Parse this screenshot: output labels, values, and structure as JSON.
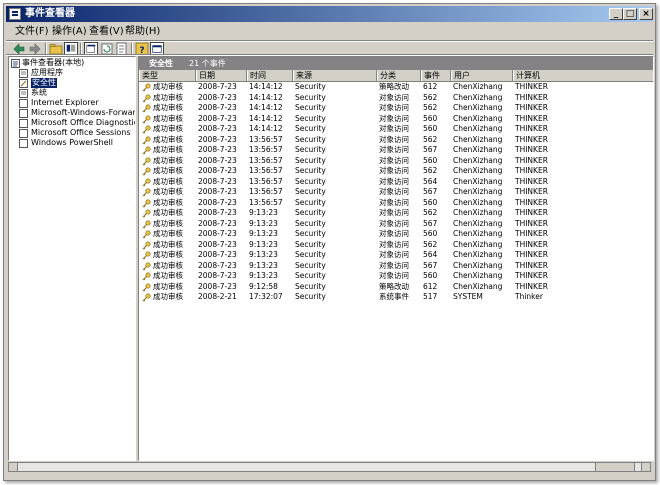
{
  "window": {
    "title": "事件查看器",
    "min_label": "_",
    "max_label": "□",
    "close_label": "×"
  },
  "menu": [
    "文件(F)",
    "操作(A)",
    "查看(V)",
    "帮助(H)"
  ],
  "tree": {
    "root": "事件查看器(本地)",
    "items": [
      {
        "label": "应用程序"
      },
      {
        "label": "安全性",
        "selected": true
      },
      {
        "label": "系统"
      },
      {
        "label": "Internet Explorer"
      },
      {
        "label": "Microsoft-Windows-Forwarding"
      },
      {
        "label": "Microsoft Office Diagnostics"
      },
      {
        "label": "Microsoft Office Sessions"
      },
      {
        "label": "Windows PowerShell"
      }
    ]
  },
  "right": {
    "pane_title": "安全性",
    "event_count": "21 个事件",
    "columns": [
      "类型",
      "日期",
      "时间",
      "来源",
      "分类",
      "事件",
      "用户",
      "计算机"
    ],
    "rows": [
      [
        "成功审核",
        "2008-7-23",
        "14:14:12",
        "Security",
        "策略改动",
        "612",
        "ChenXizhang",
        "THINKER"
      ],
      [
        "成功审核",
        "2008-7-23",
        "14:14:12",
        "Security",
        "对象访问",
        "562",
        "ChenXizhang",
        "THINKER"
      ],
      [
        "成功审核",
        "2008-7-23",
        "14:14:12",
        "Security",
        "对象访问",
        "562",
        "ChenXizhang",
        "THINKER"
      ],
      [
        "成功审核",
        "2008-7-23",
        "14:14:12",
        "Security",
        "对象访问",
        "560",
        "ChenXizhang",
        "THINKER"
      ],
      [
        "成功审核",
        "2008-7-23",
        "14:14:12",
        "Security",
        "对象访问",
        "560",
        "ChenXizhang",
        "THINKER"
      ],
      [
        "成功审核",
        "2008-7-23",
        "13:56:57",
        "Security",
        "对象访问",
        "562",
        "ChenXizhang",
        "THINKER"
      ],
      [
        "成功审核",
        "2008-7-23",
        "13:56:57",
        "Security",
        "对象访问",
        "567",
        "ChenXizhang",
        "THINKER"
      ],
      [
        "成功审核",
        "2008-7-23",
        "13:56:57",
        "Security",
        "对象访问",
        "560",
        "ChenXizhang",
        "THINKER"
      ],
      [
        "成功审核",
        "2008-7-23",
        "13:56:57",
        "Security",
        "对象访问",
        "562",
        "ChenXizhang",
        "THINKER"
      ],
      [
        "成功审核",
        "2008-7-23",
        "13:56:57",
        "Security",
        "对象访问",
        "564",
        "ChenXizhang",
        "THINKER"
      ],
      [
        "成功审核",
        "2008-7-23",
        "13:56:57",
        "Security",
        "对象访问",
        "567",
        "ChenXizhang",
        "THINKER"
      ],
      [
        "成功审核",
        "2008-7-23",
        "13:56:57",
        "Security",
        "对象访问",
        "560",
        "ChenXizhang",
        "THINKER"
      ],
      [
        "成功审核",
        "2008-7-23",
        "9:13:23",
        "Security",
        "对象访问",
        "562",
        "ChenXizhang",
        "THINKER"
      ],
      [
        "成功审核",
        "2008-7-23",
        "9:13:23",
        "Security",
        "对象访问",
        "567",
        "ChenXizhang",
        "THINKER"
      ],
      [
        "成功审核",
        "2008-7-23",
        "9:13:23",
        "Security",
        "对象访问",
        "560",
        "ChenXizhang",
        "THINKER"
      ],
      [
        "成功审核",
        "2008-7-23",
        "9:13:23",
        "Security",
        "对象访问",
        "562",
        "ChenXizhang",
        "THINKER"
      ],
      [
        "成功审核",
        "2008-7-23",
        "9:13:23",
        "Security",
        "对象访问",
        "564",
        "ChenXizhang",
        "THINKER"
      ],
      [
        "成功审核",
        "2008-7-23",
        "9:13:23",
        "Security",
        "对象访问",
        "567",
        "ChenXizhang",
        "THINKER"
      ],
      [
        "成功审核",
        "2008-7-23",
        "9:13:23",
        "Security",
        "对象访问",
        "560",
        "ChenXizhang",
        "THINKER"
      ],
      [
        "成功审核",
        "2008-7-23",
        "9:12:58",
        "Security",
        "策略改动",
        "612",
        "ChenXizhang",
        "THINKER"
      ],
      [
        "成功审核",
        "2008-2-21",
        "17:32:07",
        "Security",
        "系统事件",
        "517",
        "SYSTEM",
        "Thinker"
      ]
    ]
  },
  "colors": {
    "title_start": "#0a246a",
    "title_end": "#a6caf0",
    "header_bar": "#848284",
    "face": "#d4d0c8",
    "selected": "#0a246a"
  }
}
